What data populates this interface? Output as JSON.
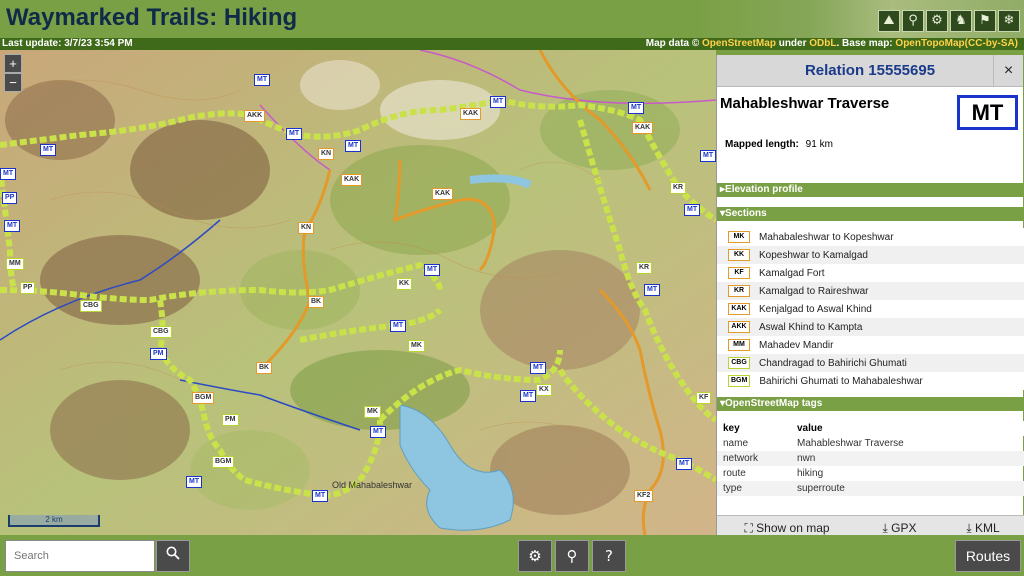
{
  "header": {
    "title": "Waymarked Trails: Hiking",
    "theme_icons": [
      "hiking-icon",
      "cycling-icon",
      "mtb-icon",
      "riding-icon",
      "skating-icon",
      "slopes-icon"
    ]
  },
  "subheader": {
    "last_update": "Last update: 3/7/23 3:54 PM",
    "map_data_prefix": "Map data © ",
    "osm": "OpenStreetMap",
    "under": " under ",
    "odbl": "ODbL",
    "basemap_prefix": ". Base map: ",
    "basemap": "OpenTopoMap(CC-by-SA)"
  },
  "map": {
    "zoom_in": "+",
    "zoom_out": "−",
    "scale": "2 km",
    "place_label": "Old Mahabaleshwar",
    "badges": [
      "AKK",
      "MT",
      "KN",
      "MT",
      "MT",
      "KAK",
      "MT",
      "MT",
      "KAK",
      "KAK",
      "KN",
      "MT",
      "PP",
      "MT",
      "MM",
      "PP",
      "CBG",
      "KK",
      "BK",
      "MT",
      "CBG",
      "PM",
      "MT",
      "MK",
      "BK",
      "BGM",
      "MK",
      "MT",
      "PM",
      "BGM",
      "MT",
      "MT",
      "MT",
      "KR",
      "MT",
      "KR",
      "MT",
      "KX",
      "KF",
      "MT",
      "KF2",
      "KAK",
      "MT",
      "MT",
      "MT"
    ]
  },
  "panel": {
    "relation": "Relation 15555695",
    "close": "×",
    "route_name": "Mahableshwar Traverse",
    "logo": "MT",
    "mapped_length_label": "Mapped length:",
    "mapped_length_value": "91 km",
    "elevation_header": "Elevation profile",
    "sections_header": "Sections",
    "sections": [
      {
        "badge": "MK",
        "name": "Mahabaleshwar to Kopeshwar"
      },
      {
        "badge": "KK",
        "name": "Kopeshwar to Kamalgad"
      },
      {
        "badge": "KF",
        "name": "Kamalgad Fort"
      },
      {
        "badge": "KR",
        "name": "Kamalgad to Raireshwar"
      },
      {
        "badge": "KAK",
        "name": "Kenjalgad to Aswal Khind"
      },
      {
        "badge": "AKK",
        "name": "Aswal Khind to Kampta"
      },
      {
        "badge": "MM",
        "name": "Mahadev Mandir"
      },
      {
        "badge": "CBG",
        "name": "Chandragad to Bahirichi Ghumati"
      },
      {
        "badge": "BGM",
        "name": "Bahirichi Ghumati to Mahabaleshwar"
      }
    ],
    "tags_header": "OpenStreetMap tags",
    "tags_key_col": "key",
    "tags_value_col": "value",
    "tags": [
      {
        "k": "name",
        "v": "Mahableshwar Traverse"
      },
      {
        "k": "network",
        "v": "nwn"
      },
      {
        "k": "route",
        "v": "hiking"
      },
      {
        "k": "type",
        "v": "superroute"
      }
    ],
    "footer": {
      "show_on_map": "Show on map",
      "gpx": "GPX",
      "kml": "KML"
    }
  },
  "bottom": {
    "search_placeholder": "Search",
    "routes": "Routes"
  },
  "colors": {
    "brand_green": "#7aa045",
    "dark_green": "#3f6a1a",
    "title_navy": "#102a4a",
    "route_yellow": "#c9e24a",
    "route_orange": "#e39a2a",
    "badge_blue": "#1a33c8"
  }
}
